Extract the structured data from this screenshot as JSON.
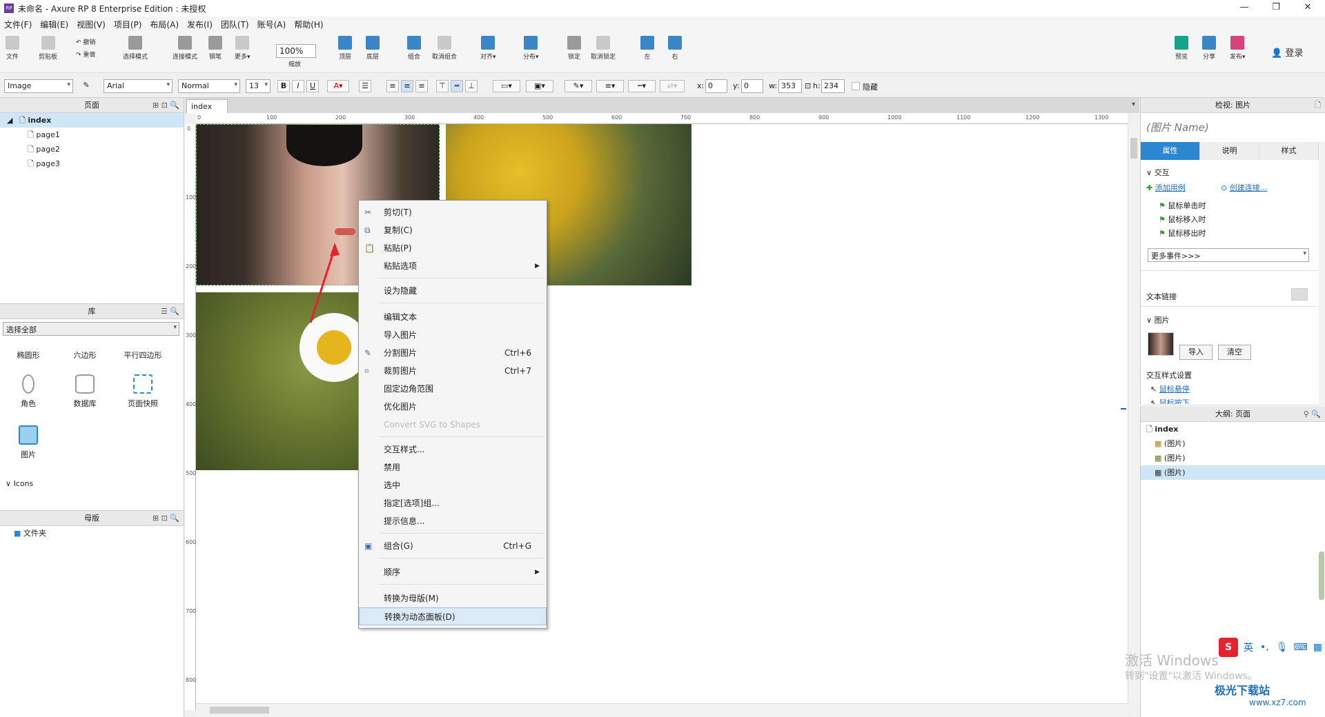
{
  "window": {
    "title": "未命名 - Axure RP 8 Enterprise Edition : 未授权",
    "app_icon_text": "RP"
  },
  "menubar": {
    "items": [
      "文件(F)",
      "编辑(E)",
      "视图(V)",
      "项目(P)",
      "布局(A)",
      "发布(I)",
      "团队(T)",
      "账号(A)",
      "帮助(H)"
    ]
  },
  "toolbar": {
    "file": "文件",
    "clipboard": "剪贴板",
    "undo": "撤销",
    "redo": "重做",
    "select_mode": "选择模式",
    "connect_mode": "连接模式",
    "pen": "钢笔",
    "more": "更多▾",
    "zoom_value": "100%",
    "zoom_label": "缩放",
    "top": "顶层",
    "bottom": "底层",
    "group": "组合",
    "ungroup": "取消组合",
    "align": "对齐▾",
    "distribute": "分布▾",
    "lock": "锁定",
    "unlock": "取消锁定",
    "left": "左",
    "right": "右",
    "preview": "预览",
    "share": "分享",
    "publish": "发布▾",
    "login": "登录"
  },
  "format_bar": {
    "widget_type": "Image",
    "font": "Arial",
    "style": "Normal",
    "size": "13",
    "x_label": "x:",
    "x": "0",
    "y_label": "y:",
    "y": "0",
    "w_label": "w:",
    "w": "353",
    "h_label": "h:",
    "h": "234",
    "hidden_label": "隐藏"
  },
  "pages_panel": {
    "title": "页面",
    "pages": [
      "index",
      "page1",
      "page2",
      "page3"
    ]
  },
  "library_panel": {
    "title": "库",
    "dropdown": "选择全部",
    "row1": [
      "椭圆形",
      "六边形",
      "平行四边形"
    ],
    "row2": [
      "角色",
      "数据库",
      "页面快照"
    ],
    "row3": [
      "图片"
    ],
    "icons_section": "Icons"
  },
  "masters_panel": {
    "title": "母版",
    "folder": "文件夹"
  },
  "canvas": {
    "tab": "index",
    "ruler_top": [
      "0",
      "100",
      "200",
      "300",
      "400",
      "500",
      "600",
      "700",
      "800",
      "900",
      "1000",
      "1100",
      "1200",
      "1300"
    ],
    "ruler_left": [
      "0",
      "100",
      "200",
      "300",
      "400",
      "500",
      "600",
      "700",
      "800"
    ]
  },
  "context_menu": {
    "items": [
      {
        "label": "剪切(T)",
        "shortcut": ""
      },
      {
        "label": "复制(C)",
        "shortcut": ""
      },
      {
        "label": "粘贴(P)",
        "shortcut": ""
      },
      {
        "label": "粘贴选项",
        "shortcut": ""
      },
      {
        "label": "设为隐藏",
        "shortcut": ""
      },
      {
        "label": "编辑文本",
        "shortcut": ""
      },
      {
        "label": "导入图片",
        "shortcut": ""
      },
      {
        "label": "分割图片",
        "shortcut": "Ctrl+6"
      },
      {
        "label": "裁剪图片",
        "shortcut": "Ctrl+7"
      },
      {
        "label": "固定边角范围",
        "shortcut": ""
      },
      {
        "label": "优化图片",
        "shortcut": ""
      },
      {
        "label": "Convert SVG to Shapes",
        "shortcut": ""
      },
      {
        "label": "交互样式...",
        "shortcut": ""
      },
      {
        "label": "禁用",
        "shortcut": ""
      },
      {
        "label": "选中",
        "shortcut": ""
      },
      {
        "label": "指定[选项]组...",
        "shortcut": ""
      },
      {
        "label": "提示信息...",
        "shortcut": ""
      },
      {
        "label": "组合(G)",
        "shortcut": "Ctrl+G"
      },
      {
        "label": "顺序",
        "shortcut": ""
      },
      {
        "label": "转换为母版(M)",
        "shortcut": ""
      },
      {
        "label": "转换为动态面板(D)",
        "shortcut": ""
      }
    ]
  },
  "inspector": {
    "title": "检视: 图片",
    "name_placeholder": "(图片 Name)",
    "tabs": [
      "属性",
      "说明",
      "样式"
    ],
    "interaction_section": "交互",
    "add_case": "添加用例",
    "create_link": "创建连接...",
    "events": [
      "鼠标单击时",
      "鼠标移入时",
      "鼠标移出时"
    ],
    "more_events": "更多事件>>>",
    "text_link": "文本链接",
    "image_section": "图片",
    "import_btn": "导入",
    "clear_btn": "清空",
    "interaction_style": "交互样式设置",
    "hover": "鼠标悬停",
    "mousedown": "鼠标按下"
  },
  "outline": {
    "title": "大纲: 页面",
    "root": "index",
    "items": [
      "(图片)",
      "(图片)",
      "(图片)"
    ]
  },
  "overlay": {
    "activate_line1": "激活 Windows",
    "activate_line2": "转到\"设置\"以激活 Windows。",
    "ime_lang": "英",
    "site_name": "极光下载站",
    "site_url": "www.xz7.com"
  }
}
